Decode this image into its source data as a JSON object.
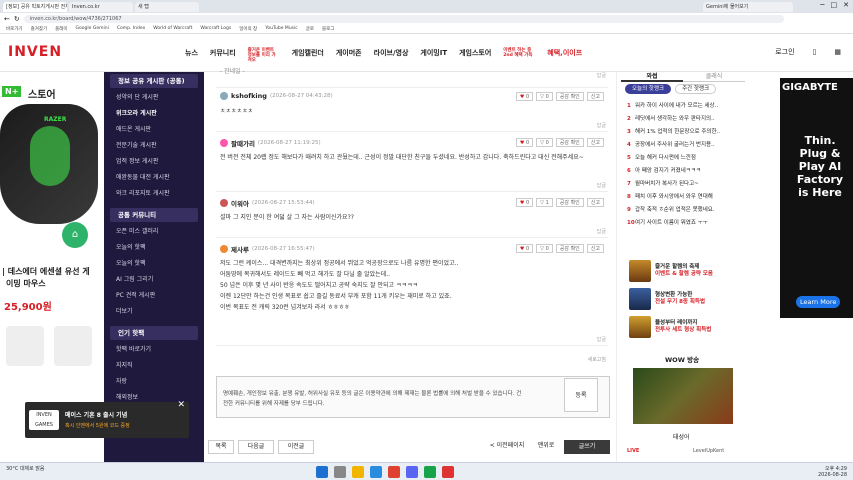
{
  "browser": {
    "tabs": [
      "[정보] 공유 빅토지게시판 전체",
      "Inven.co.kr",
      "새 탭",
      "Gemini에 물어보기"
    ],
    "url": "inven.co.kr/board/wow/4736/271067",
    "bookmarks": [
      "바로가기",
      "즐겨찾기",
      "플레이",
      "Google Gemini",
      "Comp. Index",
      "World of Warcraft",
      "Warcraft Logs",
      "일어의 창",
      "YouTube Music",
      "글로",
      "블로그"
    ]
  },
  "header": {
    "logo": "INVEN",
    "nav": [
      "뉴스",
      "커뮤니티",
      "게임캘린더",
      "게이머존",
      "라이브/영상",
      "게이밍IT",
      "게임스토어",
      "혜택,이이프"
    ],
    "nav_promo": "즐거운 이벤트 정보를 미리 가져오",
    "store_promo": "이벤트 하는 중 2nd 혜택 가득",
    "login": "로그인"
  },
  "left_ad": {
    "badge": "N+",
    "title": "스토어",
    "brand": "RAZER",
    "line1": "| 데스에더 에센셜 유선 게",
    "line2": "이밍 마우스",
    "price": "25,900원"
  },
  "sidebar": {
    "section1": "정보 공유 게시판 (공통)",
    "items1": [
      "성약의 단 게시판",
      "위크오라 게시판",
      "애드온 게시판",
      "전문기술 게시판",
      "업적 정보 게시판",
      "애완동물 대전 게시판",
      "와크 리포지토 게시판"
    ],
    "section2": "공통 커뮤니티",
    "items2": [
      "오픈 미스 갤러리",
      "오늘의 핫팩",
      "오늘의 핫팩",
      "AI 그림 그리기",
      "PC 견적 게시판",
      "더보기"
    ],
    "section3": "인기 핫팩",
    "items3": [
      "핫팩 바로가기",
      "지지직",
      "자랑"
    ],
    "items4": [
      "해외정보",
      "해외게임정보",
      "게임 영상"
    ]
  },
  "comments": [
    {
      "author": "",
      "date": "",
      "text": "- 잔네일 -",
      "buttons": [
        "답글"
      ]
    },
    {
      "author": "kshofking",
      "date": "(2026-08-27 04:43:28)",
      "text": "ㅊㅊㅊㅊㅊㅊ",
      "up": "0",
      "down": "0",
      "btn1": "공감 확인",
      "btn2": "신고",
      "reply": "답글"
    },
    {
      "author": "팔때가리",
      "date": "(2026-08-27 11:19:25)",
      "text": "전 버전 전체 20렙 정도 해보다가 때려치 하고 관뒀는데.. 근성이 정말 대단한 친구들 두셨네요. 반성하고 갑니다. 축하드린다고 대신 전해주세요~",
      "up": "0",
      "down": "0",
      "btn1": "공감 확인",
      "btn2": "신고",
      "reply": "답글"
    },
    {
      "author": "이워아",
      "date": "(2026-08-27 15:53:44)",
      "text": "설마 그 지인 분이 한 여덟 살 그 자는 사람이신가요??",
      "up": "0",
      "down": "1",
      "btn1": "공감 확인",
      "btn2": "신고",
      "reply": "답글"
    },
    {
      "author": "제사루",
      "date": "(2026-08-27 16:55:47)",
      "text": "저도 그런 케이스... 대격변까지는 최상위 정공에서 뛰었고 억공장으로도 나름 유명한 편이었고..\n어둠땅에 복귀해서도 레이드도 빼 먹고 해가도 잘 다닐 줄 알았는데..\n50 넘은 이후 몇 년 사이 반응 속도도 떨어지고 공략 숙지도 잘 안되고 ㅋㅋㅋㅋ\n이젠 12단만 하는건 인생 목표로 쉽고 즐길 동료서 부캐 포함 11개 키우는 재미로 하고 있죠.\n이번 목표도 전 캐릭 320런 넘겨보자 라서 ㅎㅎㅎㅎ",
      "up": "0",
      "down": "0",
      "btn1": "공감 확인",
      "btn2": "신고",
      "reply": "답글"
    }
  ],
  "refresh": "새로고침",
  "write": {
    "placeholder": "명예훼손, 개인정보 유출, 분쟁 유발, 허위사실 유포 등의 글은 이용약관에 의해 제재는 물론 법률에 의해 처벌 받을 수 있습니다. 건전한 커뮤니티를 위해 자제를 당부 드립니다.",
    "submit": "등록"
  },
  "pager": {
    "list": "목록",
    "next": "다음글",
    "prev": "이전글",
    "prev_page": "< 이전페이지",
    "first": "맨위로",
    "write": "글쓰기"
  },
  "right": {
    "tabs": [
      "와썹",
      "클래식"
    ],
    "sub": [
      "오늘의 핫랭크",
      "주간 핫랭크"
    ],
    "ranks": [
      {
        "n": "1",
        "t": "워카 하이 사이에 내가 모르는 세상.."
      },
      {
        "n": "2",
        "t": "레딧에서 생각하는 와우 판타지의.."
      },
      {
        "n": "3",
        "t": "해커 1% 업적의 한문장으로 주의한.."
      },
      {
        "n": "4",
        "t": "공장에서 주사위 굴러는거 번지용.."
      },
      {
        "n": "5",
        "t": "오늘 해커 다시펀에 느낀점"
      },
      {
        "n": "6",
        "t": "아 째앙 검지기 커졌네ㅋㅋㅋ"
      },
      {
        "n": "7",
        "t": "월마버치가 복사가 된다고~"
      },
      {
        "n": "8",
        "t": "패치 이후 와시앙에서 와우 연대해"
      },
      {
        "n": "9",
        "t": "갑작 축적 ㅎ순위 업적은 못했네요."
      },
      {
        "n": "10",
        "t": "여기 사이트 이름이 뭐였죠 ㅜㅜ"
      }
    ],
    "events": [
      {
        "a": "즐거운 할렘의 축제",
        "b": "이벤트 & 할렘 공략 모음"
      },
      {
        "a": "형상변환 가능한",
        "b": "전설 무기 8종 획득법"
      },
      {
        "a": "블성부터 레이까지",
        "b": "전투사 세트 형상 획득법"
      }
    ],
    "wow_title": "WOW 방송",
    "wow_name": "태성어",
    "live": "LIVE",
    "streamer": "LevelUpKent"
  },
  "right_ad": {
    "brand": "GIGABYTE",
    "text": "Thin. Plug & Play AI Factory is Here",
    "cta": "Learn More"
  },
  "toast": {
    "game": "INVEN GAMES",
    "title": "메이스 기혼 8 출시 기념",
    "sub": "혹시 인벤에서 5원에 코드 증정"
  },
  "taskbar": {
    "weather": "30°C 대체로 맑음",
    "time": "오후 4:29",
    "date": "2026-08-28"
  }
}
